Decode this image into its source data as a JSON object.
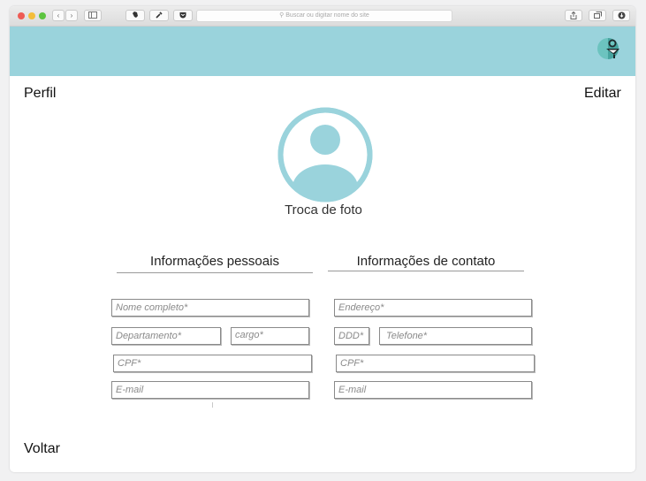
{
  "browser": {
    "address_placeholder": "Buscar ou digitar nome do site"
  },
  "app": {
    "accent_color": "#9ad3dc",
    "logo_icon": "user-pin-icon"
  },
  "page": {
    "title": "Perfil",
    "edit_label": "Editar",
    "photo_label": "Troca de foto",
    "back_label": "Voltar"
  },
  "personal": {
    "title": "Informações pessoais",
    "full_name_placeholder": "Nome completo*",
    "department_placeholder": "Departamento*",
    "role_placeholder": "cargo*",
    "cpf_placeholder": "CPF*",
    "email_placeholder": "E-mail"
  },
  "contact": {
    "title": "Informações de contato",
    "address_placeholder": "Endereço*",
    "ddd_placeholder": "DDD*",
    "phone_placeholder": "Telefone*",
    "cpf_placeholder": "CPF*",
    "email_placeholder": "E-mail"
  }
}
